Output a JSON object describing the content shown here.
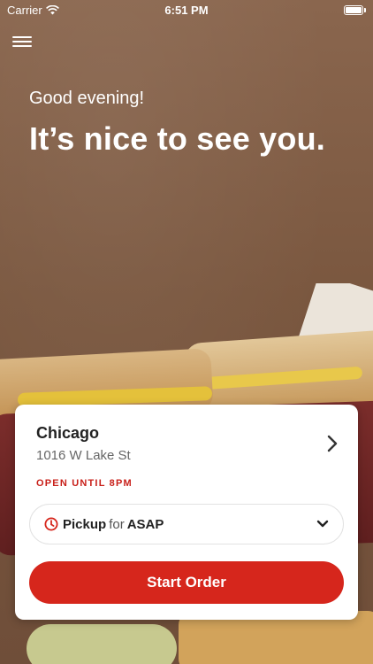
{
  "status_bar": {
    "carrier": "Carrier",
    "time": "6:51 PM"
  },
  "greeting": {
    "small": "Good evening!",
    "large": "It’s nice to see you."
  },
  "location": {
    "name": "Chicago",
    "address": "1016 W Lake St",
    "status": "OPEN UNTIL 8PM"
  },
  "order_mode": {
    "mode": "Pickup",
    "connector": "for",
    "timing": "ASAP"
  },
  "actions": {
    "start_order": "Start Order"
  },
  "colors": {
    "accent": "#d6261c",
    "status_red": "#c8201a",
    "background": "#7d5a44"
  },
  "icons": {
    "menu": "hamburger-icon",
    "wifi": "wifi-icon",
    "battery": "battery-icon",
    "clock": "clock-icon",
    "chevron_right": "chevron-right-icon",
    "chevron_down": "chevron-down-icon"
  }
}
